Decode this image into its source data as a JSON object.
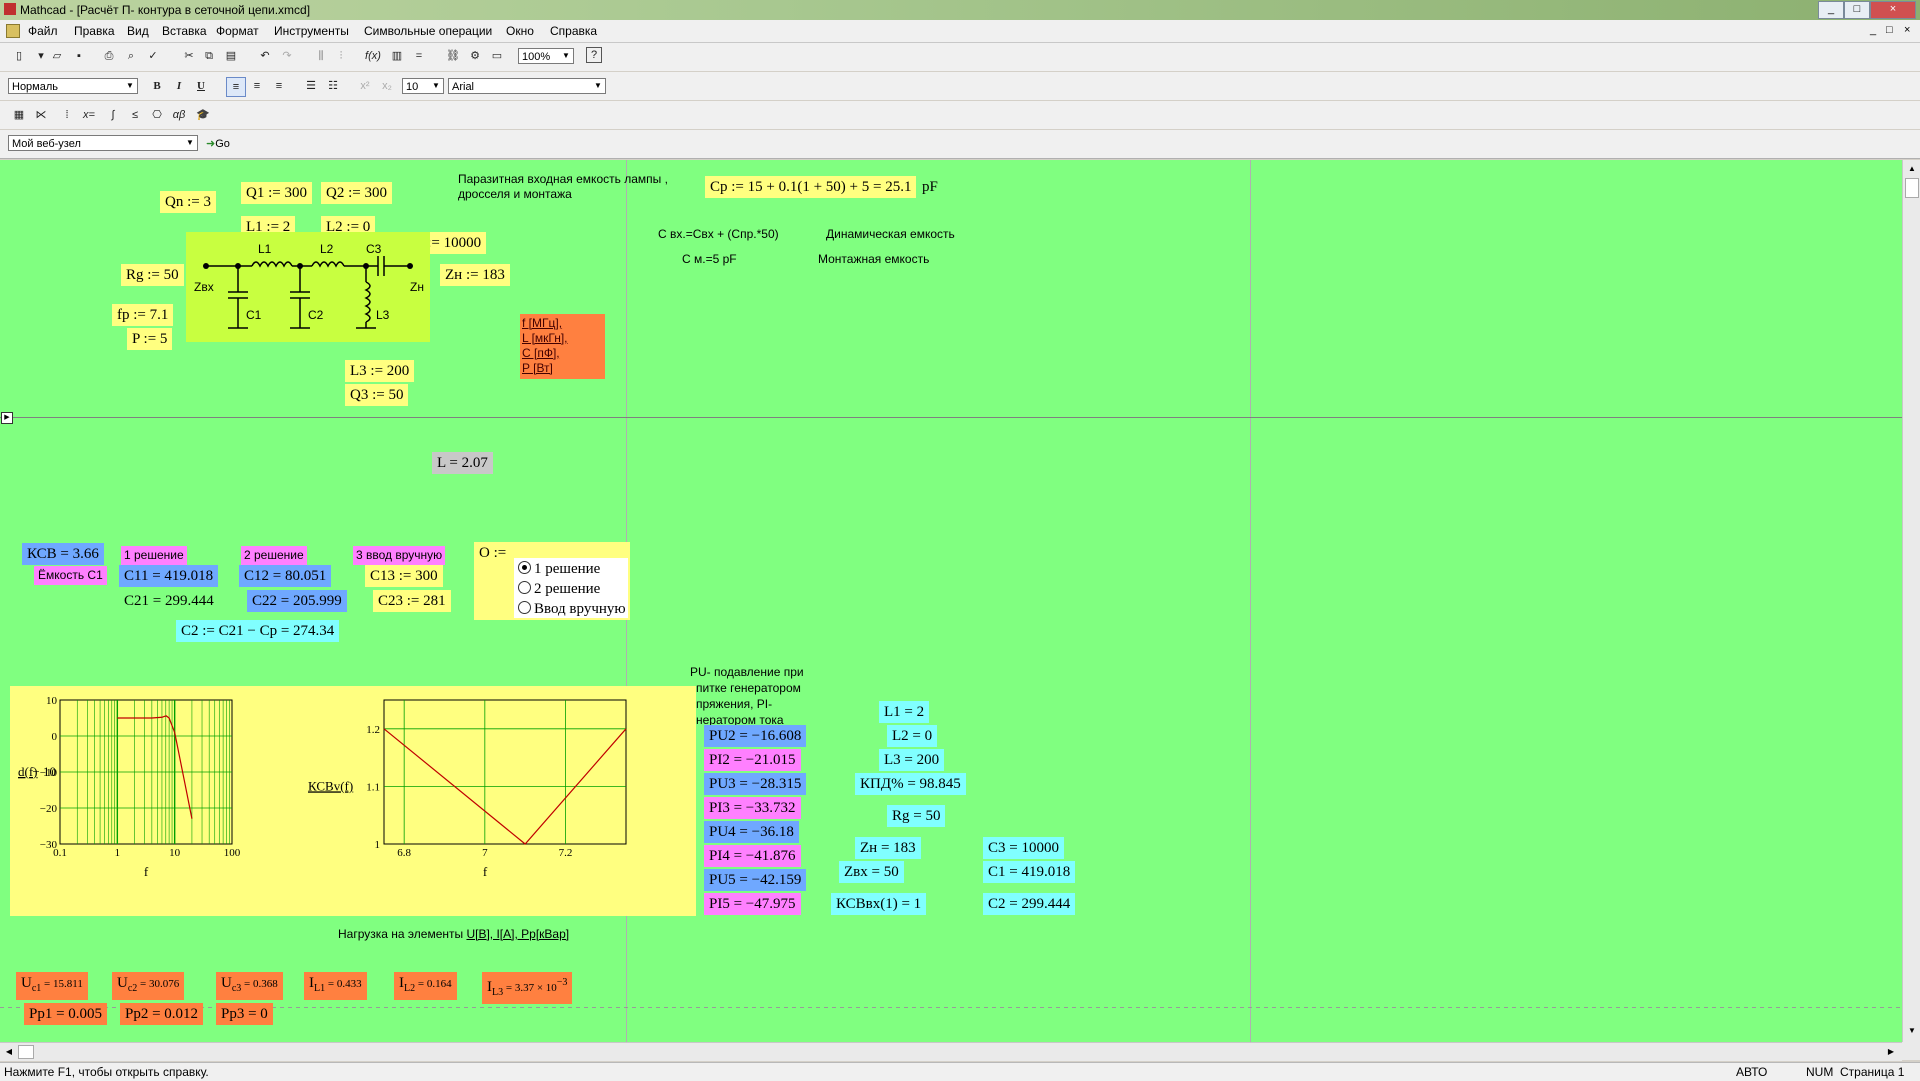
{
  "window": {
    "title": "Mathcad - [Расчёт П- контура в сеточной цепи.xmcd]",
    "min": "_",
    "max": "□",
    "close": "×"
  },
  "menu": [
    "Файл",
    "Правка",
    "Вид",
    "Вставка",
    "Формат",
    "Инструменты",
    "Символьные операции",
    "Окно",
    "Справка"
  ],
  "toolbar": {
    "zoom": "100%",
    "style": "Нормаль",
    "font_size": "10",
    "font_name": "Arial",
    "bold": "B",
    "italic": "I",
    "underline": "U",
    "web": "Мой веб-узел",
    "go": "Go"
  },
  "schematic": {
    "labels": {
      "zvx": "Zвх",
      "zn": "Zн",
      "l1": "L1",
      "l2": "L2",
      "c3": "C3",
      "c1": "C1",
      "c2": "C2",
      "l3": "L3"
    }
  },
  "inputs": {
    "qn": "Qn := 3",
    "q1": "Q1 := 300",
    "q2": "Q2 := 300",
    "l1": "L1 := 2",
    "l2": "L2 := 0",
    "c3": "C3 := 10000",
    "rg": "Rg := 50",
    "zn": "Zн := 183",
    "fr": "fр := 7.1",
    "p": "P := 5",
    "l3": "L3 := 200",
    "q3": "Q3 := 50"
  },
  "units_box": [
    "f [МГц],",
    "L [мкГн],",
    "C [пФ],",
    "P [Вт]"
  ],
  "notes": {
    "parasitic1": "Паразитная входная емкость лампы ,",
    "parasitic2": "дросселя и монтажа",
    "cp": "Cр := 15 + 0.1(1 + 50) + 5 = 25.1",
    "pf": "pF",
    "cvx": "С вх.=Свх + (Спр.*50)",
    "dyn": "Динамическая емкость",
    "cm": "С м.=5 pF",
    "mount": "Монтажная емкость"
  },
  "L": "L = 2.07",
  "ksv": "КСВ = 3.66",
  "cap_c1": "Ёмкость С1",
  "sol1": "1 решение",
  "sol2": "2 решение",
  "sol3": "3 ввод вручную",
  "c11": "C11 = 419.018",
  "c21": "C21 = 299.444",
  "c12": "C12 = 80.051",
  "c22": "C22 = 205.999",
  "c13": "C13 := 300",
  "c23": "C23 := 281",
  "c2calc": "C2 := C21 − Cр = 274.34",
  "radio": {
    "label": "O :=",
    "options": [
      "1 решение",
      "2 решение",
      "Ввод вручную"
    ]
  },
  "pu_note": [
    "PU- подавление при",
    "питке генератором",
    "пряжения, PI-",
    "нератором тока"
  ],
  "pu": [
    {
      "t": "PU2 = −16.608",
      "c": "b"
    },
    {
      "t": "PI2 = −21.015",
      "c": "p"
    },
    {
      "t": "PU3 = −28.315",
      "c": "b"
    },
    {
      "t": "PI3 = −33.732",
      "c": "p"
    },
    {
      "t": "PU4 = −36.18",
      "c": "b"
    },
    {
      "t": "PI4 = −41.876",
      "c": "p"
    },
    {
      "t": "PU5 = −42.159",
      "c": "b"
    },
    {
      "t": "PI5 = −47.975",
      "c": "p"
    }
  ],
  "results": {
    "l1": "L1 = 2",
    "l2": "L2 = 0",
    "l3": "L3 = 200",
    "kpd": "КПД% = 98.845",
    "rg": "Rg = 50",
    "zn": "Zн = 183",
    "zvx": "Zвх = 50",
    "ksvvx": "КСВвх(1) = 1",
    "c3": "C3 = 10000",
    "c1": "C1 = 419.018",
    "c2": "C2 = 299.444"
  },
  "load_title": "Нагрузка на элементы ",
  "load_units": "U[В], I[А], Pр[кВар]",
  "loads": {
    "uc1n": "U",
    "uc1s": "c1",
    "uc1v": " = 15.811",
    "uc2n": "U",
    "uc2s": "c2",
    "uc2v": " = 30.076",
    "uc3n": "U",
    "uc3s": "c3",
    "uc3v": " = 0.368",
    "il1n": "I",
    "il1s": "L1",
    "il1v": " = 0.433",
    "il2n": "I",
    "il2s": "L2",
    "il2v": " = 0.164",
    "il3n": "I",
    "il3s": "L3",
    "il3v": " = 3.37 × 10",
    "il3e": "−3",
    "pp1": "Pр1 = 0.005",
    "pp2": "Pр2 = 0.012",
    "pp3": "Pр3 = 0"
  },
  "chart_data": [
    {
      "type": "line",
      "xlabel": "f",
      "ylabel": "d(f)",
      "ylabel_suffix": "− 10",
      "xscale": "log",
      "xlim": [
        0.1,
        100
      ],
      "ylim": [
        -30,
        10
      ],
      "xticks": [
        "0.1",
        "1",
        "10",
        "100"
      ],
      "yticks": [
        "10",
        "0",
        "−10",
        "−20",
        "−30"
      ],
      "series": [
        {
          "x": [
            1,
            2,
            4,
            6,
            7.1,
            8,
            10,
            15,
            20
          ],
          "y": [
            5,
            5,
            5,
            5.2,
            5.6,
            5,
            1,
            -13,
            -23
          ]
        }
      ]
    },
    {
      "type": "line",
      "xlabel": "f",
      "ylabel": "КСВv(f)",
      "xlim": [
        6.75,
        7.35
      ],
      "ylim": [
        1.0,
        1.25
      ],
      "xticks": [
        "6.8",
        "7",
        "7.2"
      ],
      "yticks": [
        "1.2",
        "1.1",
        "1"
      ],
      "series": [
        {
          "x": [
            6.75,
            7.1,
            7.35
          ],
          "y": [
            1.2,
            1.0,
            1.2
          ]
        }
      ]
    }
  ],
  "status": {
    "help": "Нажмите F1, чтобы открыть справку.",
    "auto": "АВТО",
    "num": "NUM",
    "page": "Страница 1"
  }
}
